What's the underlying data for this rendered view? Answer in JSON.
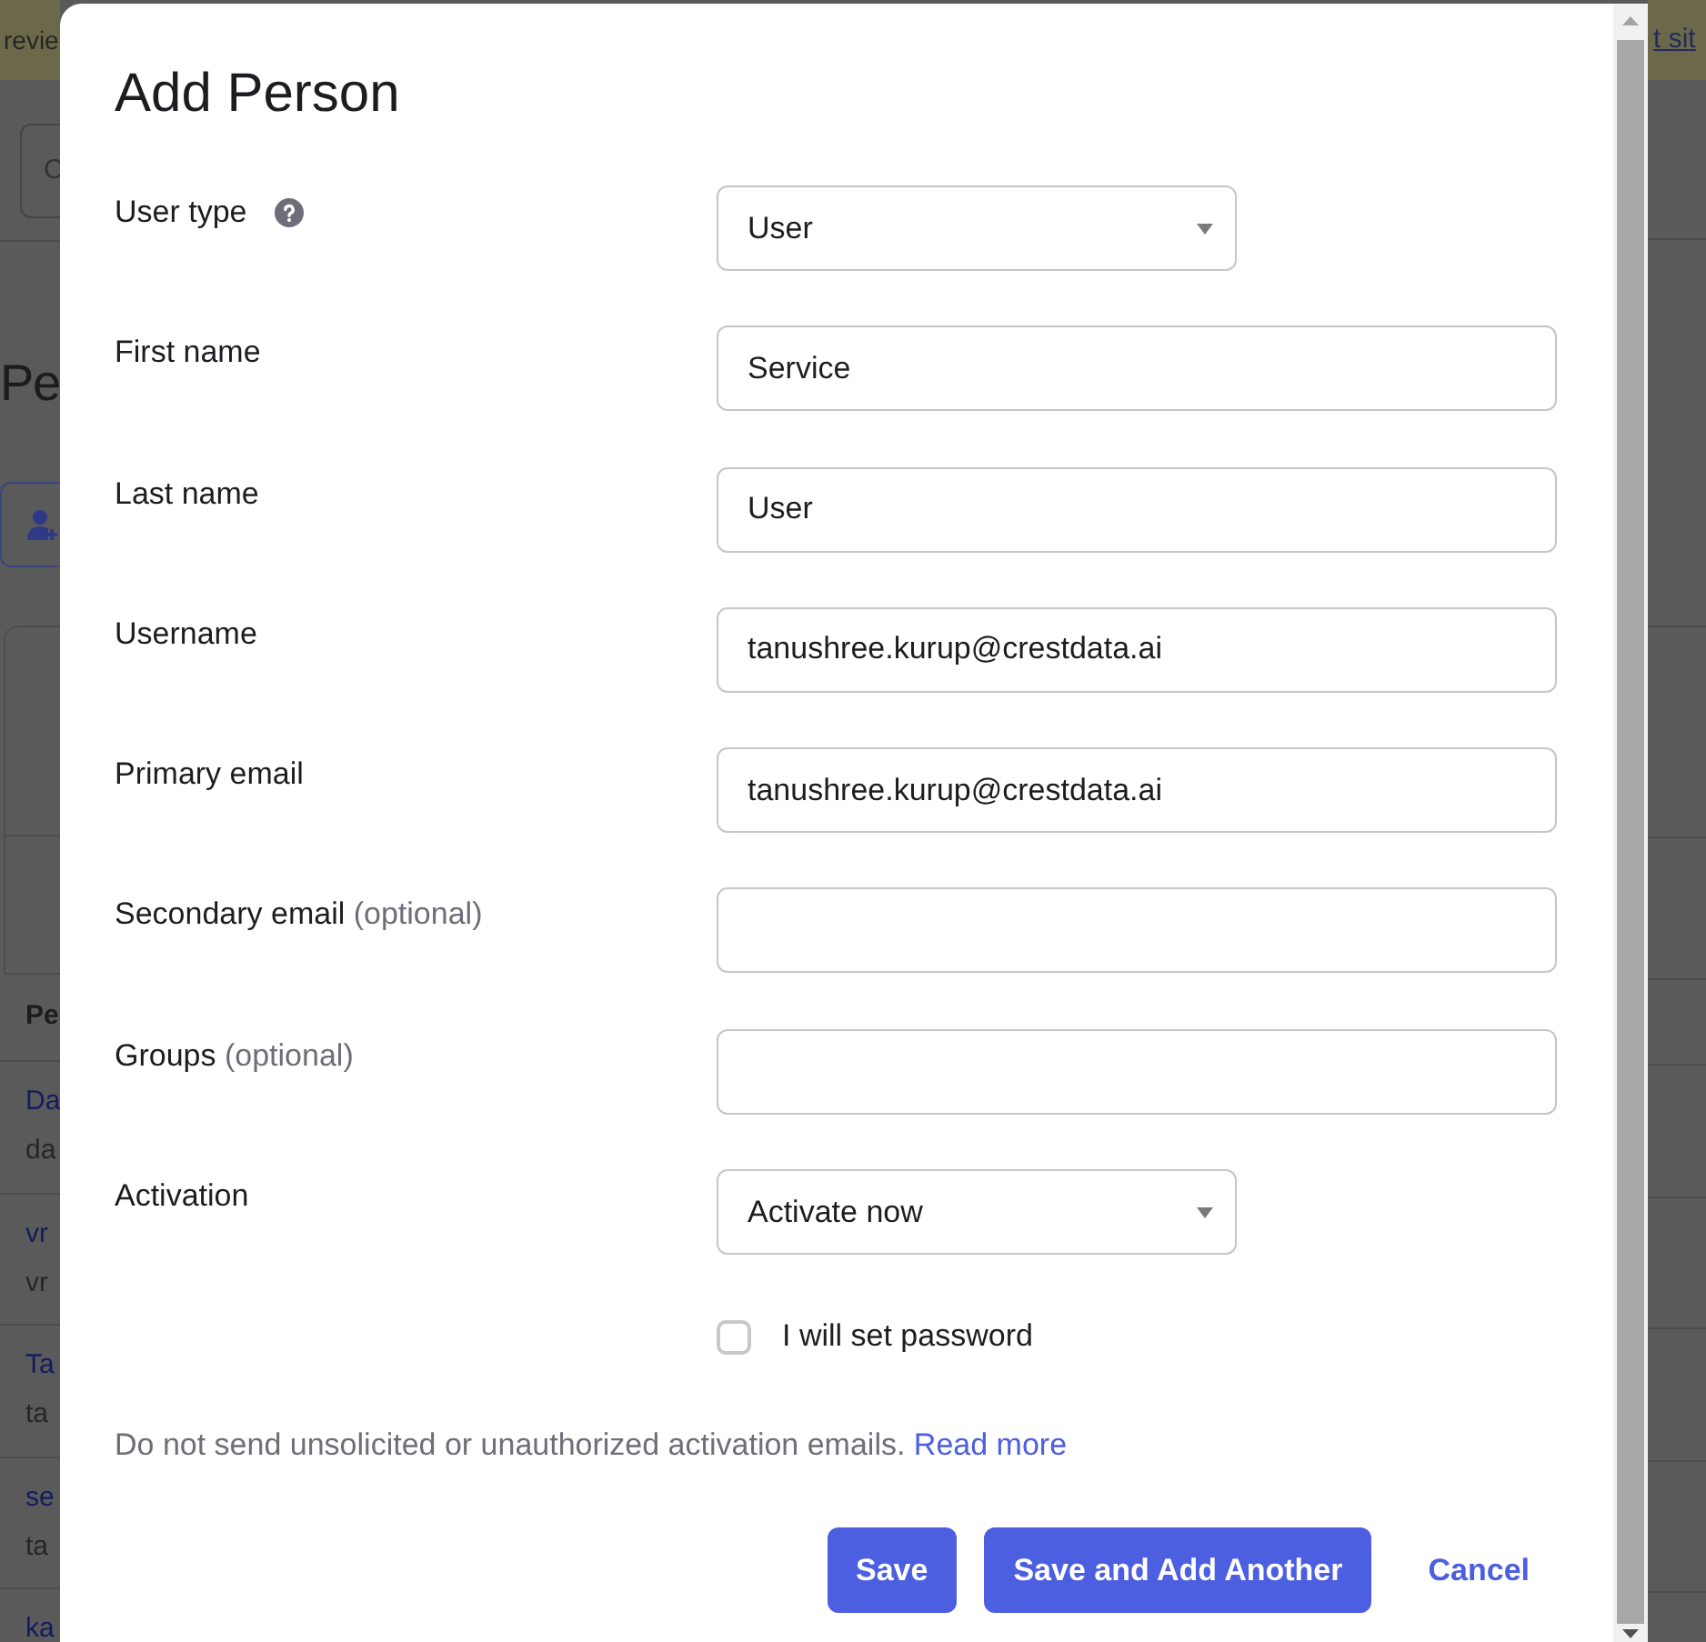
{
  "background_page": {
    "banner": {
      "text": "revie",
      "link": "t sit"
    },
    "field": {
      "text": "C"
    },
    "heading": "Pe",
    "table": {
      "columns": [
        "Pe"
      ],
      "rows": [
        {
          "title": "Da",
          "subtitle": "da"
        },
        {
          "title": "vr",
          "subtitle": "vr"
        },
        {
          "title": "Ta",
          "subtitle": "ta"
        },
        {
          "title": "se",
          "subtitle": "ta"
        },
        {
          "title": "ka"
        }
      ]
    }
  },
  "dialog": {
    "title": "Add Person",
    "fields": [
      {
        "kind": "select",
        "label": "User type",
        "help": true,
        "value": "User"
      },
      {
        "kind": "text",
        "label": "First name",
        "help": false,
        "value": "Service"
      },
      {
        "kind": "text",
        "label": "Last name",
        "help": false,
        "value": "User"
      },
      {
        "kind": "text",
        "label": "Username",
        "help": false,
        "value": "tanushree.kurup@crestdata.ai"
      },
      {
        "kind": "text",
        "label": "Primary email",
        "help": false,
        "value": "tanushree.kurup@crestdata.ai"
      },
      {
        "kind": "text",
        "label": "Secondary email",
        "help": false,
        "note": "(optional)"
      },
      {
        "kind": "text",
        "label": "Groups",
        "help": false,
        "note": "(optional)"
      },
      {
        "kind": "select",
        "label": "Activation",
        "help": false,
        "value": "Activate now"
      }
    ],
    "checkbox": {
      "label": "I will set password",
      "checked": false
    },
    "notice": {
      "text": "Do not send unsolicited or unauthorized activation emails.",
      "link": "Read more"
    },
    "buttons": [
      {
        "label": "Save",
        "kind": "primary"
      },
      {
        "label": "Save and Add Another",
        "kind": "primary"
      },
      {
        "label": "Cancel",
        "kind": "link"
      }
    ]
  }
}
